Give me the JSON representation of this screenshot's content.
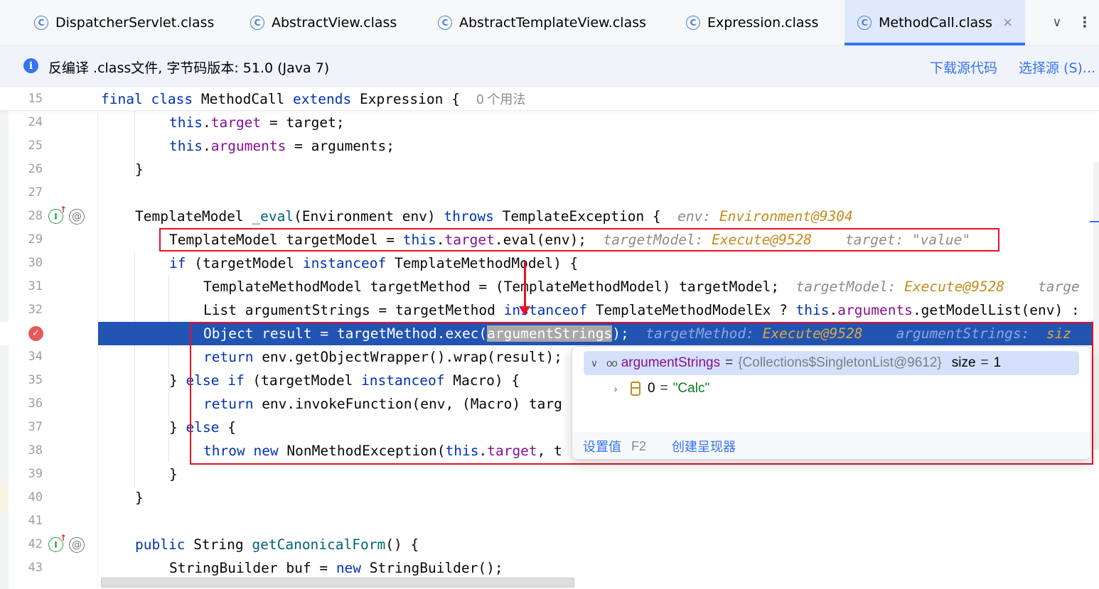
{
  "tabs": [
    {
      "label": "DispatcherServlet.class",
      "icon": "class-icon",
      "active": false
    },
    {
      "label": "AbstractView.class",
      "icon": "class-icon",
      "active": false
    },
    {
      "label": "AbstractTemplateView.class",
      "icon": "class-icon",
      "active": false
    },
    {
      "label": "Expression.class",
      "icon": "class-icon",
      "active": false
    },
    {
      "label": "MethodCall.class",
      "icon": "class-icon",
      "active": true
    }
  ],
  "tab_icon_glyph": "C",
  "tab_close": "×",
  "tab_menu": {
    "chevron": "∨",
    "more": "⋮"
  },
  "banner": {
    "icon": "i",
    "text": "反编译 .class文件, 字节码版本: 51.0 (Java 7)",
    "download": "下载源代码",
    "choose": "选择源 (S)..."
  },
  "gutter": {
    "impl_glyph": "I",
    "at_glyph": "@",
    "bp_glyph": "✓"
  },
  "line_numbers": [
    "15",
    "24",
    "25",
    "26",
    "27",
    "28",
    "29",
    "30",
    "31",
    "32",
    "",
    "34",
    "35",
    "36",
    "37",
    "38",
    "39",
    "40",
    "41",
    "42",
    "43"
  ],
  "code": {
    "l15": {
      "kw1": "final",
      "kw2": "class",
      "name": " MethodCall ",
      "kw3": "extends",
      "rest": " Expression {",
      "usage": "0 个用法"
    },
    "l24": {
      "kw": "this",
      "dot": ".",
      "field": "target",
      "rest": " = target;"
    },
    "l25": {
      "kw": "this",
      "dot": ".",
      "field": "arguments",
      "rest": " = arguments;"
    },
    "l26": {
      "text": "}"
    },
    "l28": {
      "a": "TemplateModel ",
      "fn": "_eval",
      "b": "(Environment env) ",
      "kw": "throws",
      "c": " TemplateException {",
      "h1": "env: ",
      "v1": "Environment@9304"
    },
    "l29": {
      "a": "TemplateModel targetModel = ",
      "kw": "this",
      "dot": ".",
      "field": "target",
      "b": ".eval(env);",
      "h1": "targetModel: ",
      "v1": "Execute@9528",
      "h2": "target: ",
      "v2": "\"value\""
    },
    "l30": {
      "kw": "if",
      "a": " (targetModel ",
      "kw2": "instanceof",
      "b": " TemplateMethodModel) {"
    },
    "l31": {
      "a": "TemplateMethodModel targetMethod = (TemplateMethodModel) targetModel;",
      "h1": "targetModel: ",
      "v1": "Execute@9528",
      "h2": "targe"
    },
    "l32": {
      "a": "List argumentStrings = targetMethod ",
      "kw": "instanceof",
      "b": " TemplateMethodModelEx ? ",
      "kw2": "this",
      "dot": ".",
      "field": "arguments",
      "c": ".getModelList(env) :"
    },
    "l33": {
      "a": "Object result = targetMethod.exec(",
      "sel": "argumentStrings",
      "b": ");",
      "h1": "targetMethod: ",
      "v1": "Execute@9528",
      "h2": "argumentStrings: ",
      "v2": "siz"
    },
    "l34": {
      "kw": "return",
      "a": " env.getObjectWrapper().wrap(result);"
    },
    "l35": {
      "a": "} ",
      "kw": "else",
      "sp": " ",
      "kw2": "if",
      "b": " (targetModel ",
      "kw3": "instanceof",
      "c": " Macro) {"
    },
    "l36": {
      "kw": "return",
      "a": " env.invokeFunction(env, (Macro) targ"
    },
    "l37": {
      "a": "} ",
      "kw": "else",
      "b": " {"
    },
    "l38": {
      "kw": "throw",
      "sp": " ",
      "kw2": "new",
      "a": " NonMethodException(",
      "kw3": "this",
      "dot": ".",
      "field": "target",
      "b": ", t"
    },
    "l39": {
      "text": "}"
    },
    "l40": {
      "text": "}"
    },
    "l42": {
      "kw": "public",
      "a": " String ",
      "fn": "getCanonicalForm",
      "b": "() {"
    },
    "l43": {
      "a": "StringBuilder buf = ",
      "kw": "new",
      "b": " StringBuilder();"
    }
  },
  "popup": {
    "row1": {
      "chevron": "∨",
      "icon": "glasses-icon",
      "glyph": "oo",
      "name": "argumentStrings",
      "eq": "=",
      "value": "{Collections$SingletonList@9612}",
      "size_label": "size",
      "size_eq": "=",
      "size_value": "1"
    },
    "row2": {
      "chevron": "›",
      "icon": "array-element-icon",
      "index": "0",
      "eq": "=",
      "value": "\"Calc\""
    },
    "footer": {
      "set_value": "设置值",
      "set_key": "F2",
      "create_renderer": "创建呈现器"
    }
  },
  "colors": {
    "accent": "#3574f0",
    "highlight_line": "#2154b3",
    "annotation_red": "#e81123",
    "keyword": "#0033b3",
    "field": "#871094",
    "hint_value": "#c28c1d"
  }
}
